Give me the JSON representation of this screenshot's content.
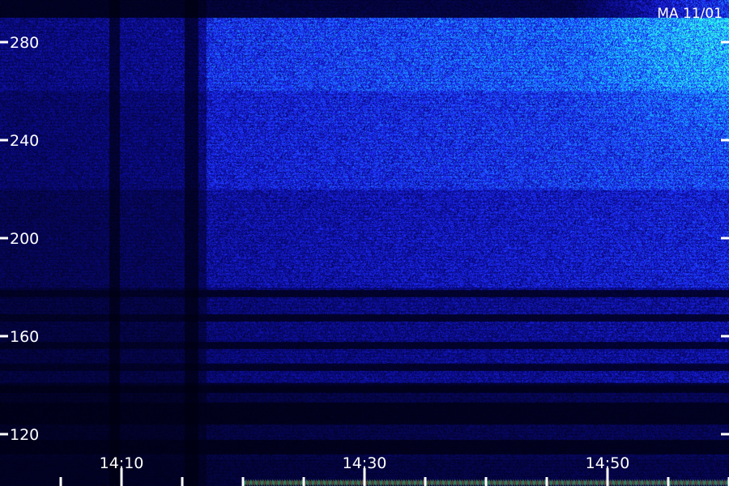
{
  "chart_data": {
    "type": "heatmap",
    "title": "",
    "corner_label": "MA 11/01",
    "xlabel": "",
    "ylabel": "",
    "x_range": [
      "14:02",
      "14:62"
    ],
    "ylim": [
      110,
      290
    ],
    "y_ticks": [
      120,
      160,
      200,
      240,
      280
    ],
    "x_tick_labels": [
      "14:10",
      "14:30",
      "14:50"
    ],
    "x_ticks_minutes": [
      10,
      30,
      50
    ],
    "x_minor_ticks_minutes": [
      5,
      15,
      20,
      25,
      35,
      40,
      45,
      55,
      60
    ],
    "colormap": [
      "#000010",
      "#0a0a8a",
      "#1e2cff",
      "#1f7bff",
      "#12d0ff",
      "#39ffe0"
    ],
    "intensity_rows": [
      {
        "y_from": 260,
        "y_to": 290,
        "level": 0.6
      },
      {
        "y_from": 220,
        "y_to": 260,
        "level": 0.48
      },
      {
        "y_from": 180,
        "y_to": 220,
        "level": 0.35
      },
      {
        "y_from": 140,
        "y_to": 180,
        "level": 0.25
      },
      {
        "y_from": 110,
        "y_to": 140,
        "level": 0.12
      }
    ],
    "dark_bands_y": [
      [
        176,
        179
      ],
      [
        166,
        169
      ],
      [
        155,
        158
      ],
      [
        146,
        149
      ],
      [
        137,
        141
      ],
      [
        124,
        133
      ],
      [
        112,
        118
      ]
    ],
    "dark_columns_minutes": [
      [
        9.0,
        9.8
      ],
      [
        15.2,
        16.3
      ]
    ],
    "bright_region": {
      "x_minutes": [
        47,
        62
      ],
      "y": [
        235,
        290
      ]
    }
  }
}
